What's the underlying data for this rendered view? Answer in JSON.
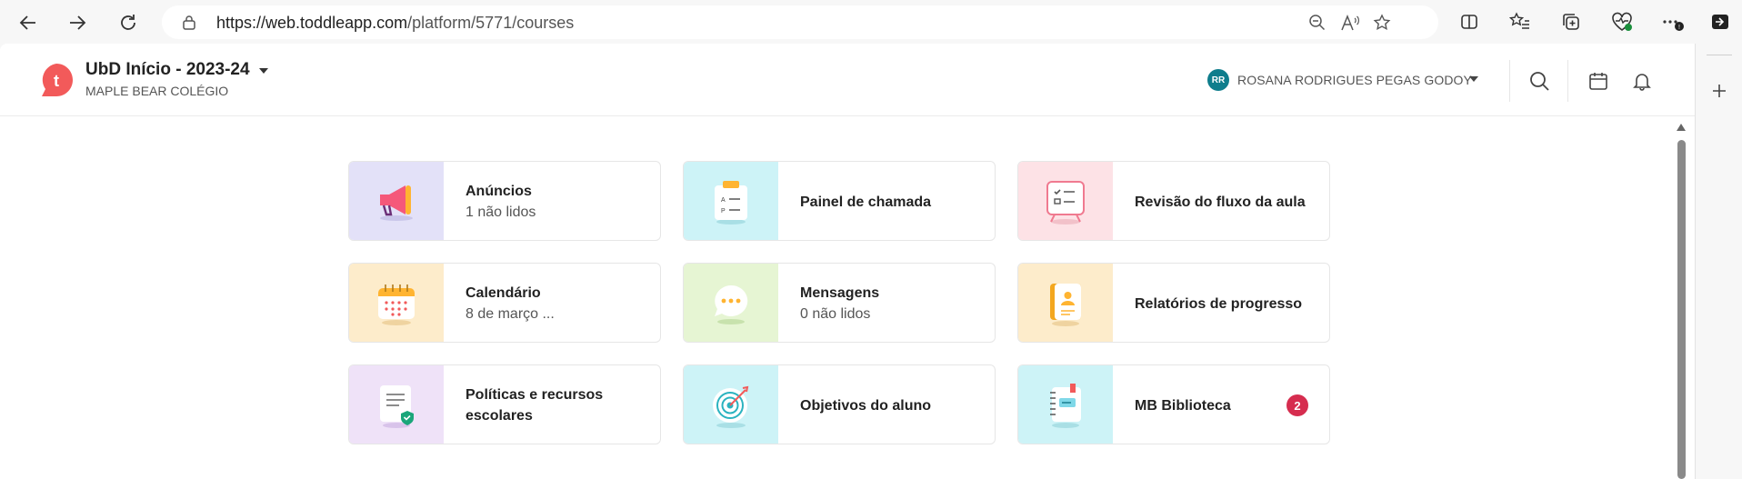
{
  "browser": {
    "url_host": "https://web.toddleapp.com",
    "url_path": "/platform/5771/courses",
    "back_icon": "arrow-left-icon",
    "forward_icon": "arrow-right-icon",
    "refresh_icon": "refresh-icon"
  },
  "header": {
    "logo_letter": "t",
    "title": "UbD Início - 2023-24",
    "school": "MAPLE BEAR COLÉGIO",
    "user_initials": "RR",
    "user_name": "ROSANA RODRIGUES PEGAS GODOY"
  },
  "cards": [
    {
      "title": "Anúncios",
      "subtitle": "1 não lidos",
      "icon": "megaphone-icon",
      "bg": "#e3e1f8"
    },
    {
      "title": "Painel de chamada",
      "subtitle": "",
      "icon": "attendance-clipboard-icon",
      "bg": "#cdf3f7"
    },
    {
      "title": "Revisão do fluxo da aula",
      "subtitle": "",
      "icon": "checklist-board-icon",
      "bg": "#fde2e6"
    },
    {
      "title": "Calendário",
      "subtitle": "8 de março ...",
      "icon": "calendar-icon",
      "bg": "#fdeccb"
    },
    {
      "title": "Mensagens",
      "subtitle": "0 não lidos",
      "icon": "chat-bubble-icon",
      "bg": "#e6f5d3"
    },
    {
      "title": "Relatórios de progresso",
      "subtitle": "",
      "icon": "report-book-icon",
      "bg": "#fdeccb"
    },
    {
      "title": "Políticas e recursos escolares",
      "subtitle": "",
      "icon": "policy-document-icon",
      "bg": "#efe2f8"
    },
    {
      "title": "Objetivos do aluno",
      "subtitle": "",
      "icon": "target-icon",
      "bg": "#cdf3f7"
    },
    {
      "title": "MB Biblioteca",
      "subtitle": "",
      "icon": "notebook-icon",
      "bg": "#cdf3f7",
      "badge": "2"
    }
  ],
  "colors": {
    "brand": "#f25a5a",
    "avatar": "#0f7d8c",
    "badge": "#d62d4f"
  }
}
